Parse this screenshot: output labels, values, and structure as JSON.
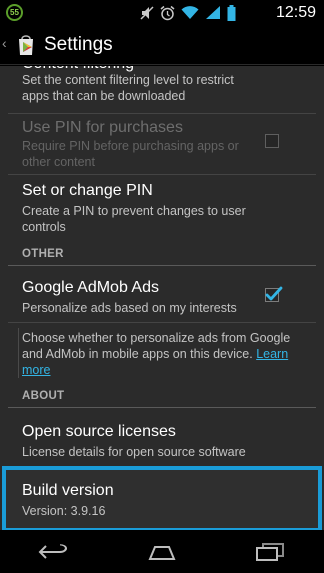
{
  "status_bar": {
    "notification_badge": "55",
    "time": "12:59"
  },
  "action_bar": {
    "title": "Settings"
  },
  "preferences": {
    "content_filtering": {
      "title": "Content filtering",
      "summary": "Set the content filtering level to restrict apps that can be downloaded"
    },
    "use_pin": {
      "title": "Use PIN for purchases",
      "summary": "Require PIN before purchasing apps or other content",
      "checked": false,
      "enabled": false
    },
    "change_pin": {
      "title": "Set or change PIN",
      "summary": "Create a PIN to prevent changes to user controls"
    }
  },
  "sections": {
    "other": "OTHER",
    "about": "ABOUT"
  },
  "admob": {
    "title": "Google AdMob Ads",
    "summary": "Personalize ads based on my interests",
    "checked": true,
    "help_text": "Choose whether to personalize ads from Google and AdMob in mobile apps on this device.",
    "learn_more": "Learn more"
  },
  "about": {
    "licenses": {
      "title": "Open source licenses",
      "summary": "License details for open source software"
    },
    "build": {
      "title": "Build version",
      "summary": "Version: 3.9.16"
    }
  },
  "colors": {
    "accent": "#33b5e5",
    "highlight_border": "#1a9cd8"
  },
  "icons": {
    "status": [
      "notification-badge-icon",
      "mute-icon",
      "alarm-icon",
      "wifi-icon",
      "signal-icon",
      "battery-icon"
    ],
    "nav": [
      "back-icon",
      "home-icon",
      "recent-apps-icon"
    ]
  }
}
